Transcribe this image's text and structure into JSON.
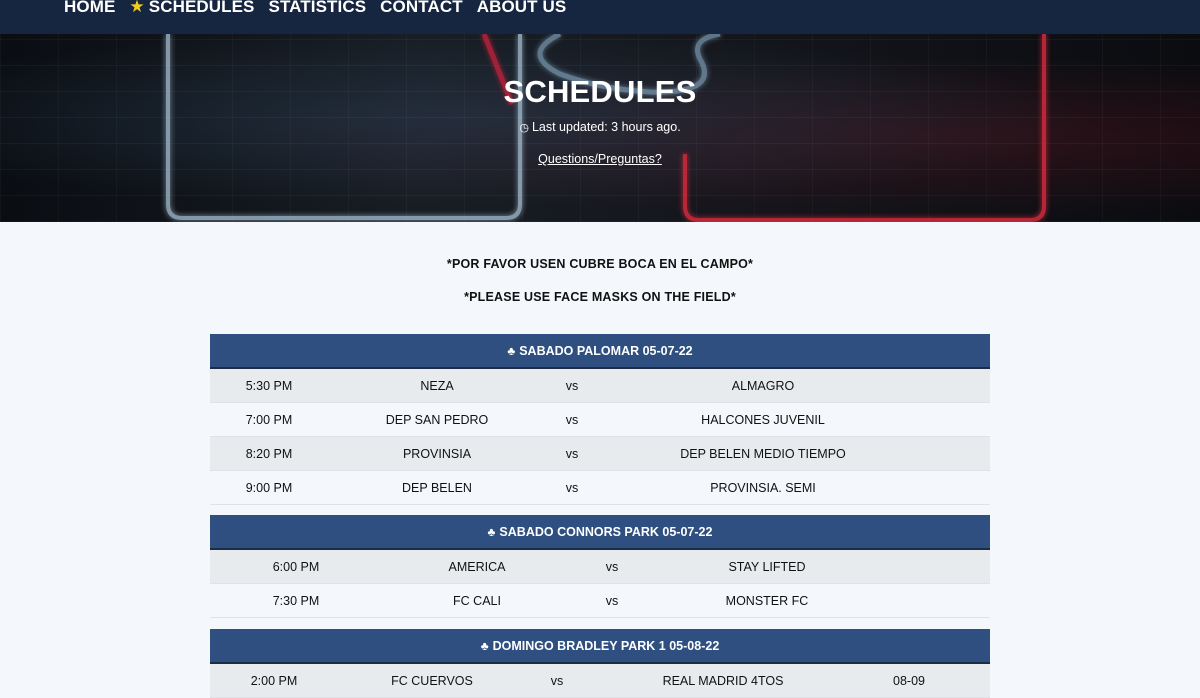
{
  "nav": {
    "items": [
      {
        "label": "HOME",
        "starred": false
      },
      {
        "label": "SCHEDULES",
        "starred": true
      },
      {
        "label": "STATISTICS",
        "starred": false
      },
      {
        "label": "CONTACT",
        "starred": false
      },
      {
        "label": "ABOUT US",
        "starred": false
      }
    ],
    "star_color": "#f2cc1c"
  },
  "hero": {
    "title": "SCHEDULES",
    "updated": "Last updated: 3 hours ago.",
    "link": "Questions/Preguntas?"
  },
  "notices": [
    "*POR FAVOR USEN CUBRE BOCA EN EL CAMPO*",
    "*PLEASE USE FACE MASKS ON THE FIELD*"
  ],
  "schedules": [
    {
      "title": "SABADO PALOMAR 05-07-22",
      "rows": [
        [
          "5:30 PM",
          "NEZA",
          "vs",
          "ALMAGRO"
        ],
        [
          "7:00 PM",
          "DEP SAN PEDRO",
          "vs",
          "HALCONES JUVENIL"
        ],
        [
          "8:20 PM",
          "PROVINSIA",
          "vs",
          "DEP BELEN MEDIO TIEMPO"
        ],
        [
          "9:00 PM",
          "DEP BELEN",
          "vs",
          "PROVINSIA. SEMI"
        ]
      ]
    },
    {
      "title": "SABADO CONNORS PARK 05-07-22",
      "rows": [
        [
          "6:00 PM",
          "AMERICA",
          "vs",
          "STAY LIFTED"
        ],
        [
          "7:30 PM",
          "FC CALI",
          "vs",
          "MONSTER FC"
        ]
      ]
    },
    {
      "title": "DOMINGO BRADLEY PARK 1 05-08-22",
      "rows": [
        [
          "2:00 PM",
          "FC CUERVOS",
          "vs",
          "REAL MADRID 4TOS",
          "08-09"
        ]
      ]
    }
  ],
  "colors": {
    "nav_bg": "#172640",
    "table_header_bg": "#2e4f80",
    "row_odd": "#e8ebee",
    "row_even": "#f4f8fc"
  }
}
